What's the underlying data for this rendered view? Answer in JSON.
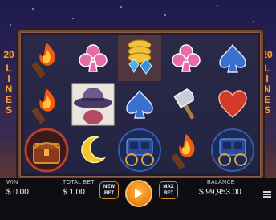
{
  "game": {
    "lines_count": "20",
    "lines_word": "LINES"
  },
  "reels": [
    [
      "torch",
      "torch",
      "treasure-chest"
    ],
    [
      "club",
      "cowboy-hat",
      "moon"
    ],
    [
      "gold-coins-gems",
      "spade",
      "stagecoach"
    ],
    [
      "club",
      "axe",
      "torch"
    ],
    [
      "spade",
      "heart",
      "stagecoach"
    ]
  ],
  "colors": {
    "accent": "#f08a1a",
    "club": "#e86aa8",
    "spade": "#3a6fd0",
    "heart": "#d23a2a"
  },
  "bottom_bar": {
    "win_label": "WIN",
    "win_value": "$ 0.00",
    "total_bet_label": "TOTAL BET",
    "total_bet_value": "$ 1.00",
    "new_bet_line1": "NEW",
    "new_bet_line2": "BET",
    "max_bet_line1": "MAX",
    "max_bet_line2": "BET",
    "balance_label": "BALANCE",
    "balance_value": "$ 99,953.00"
  }
}
